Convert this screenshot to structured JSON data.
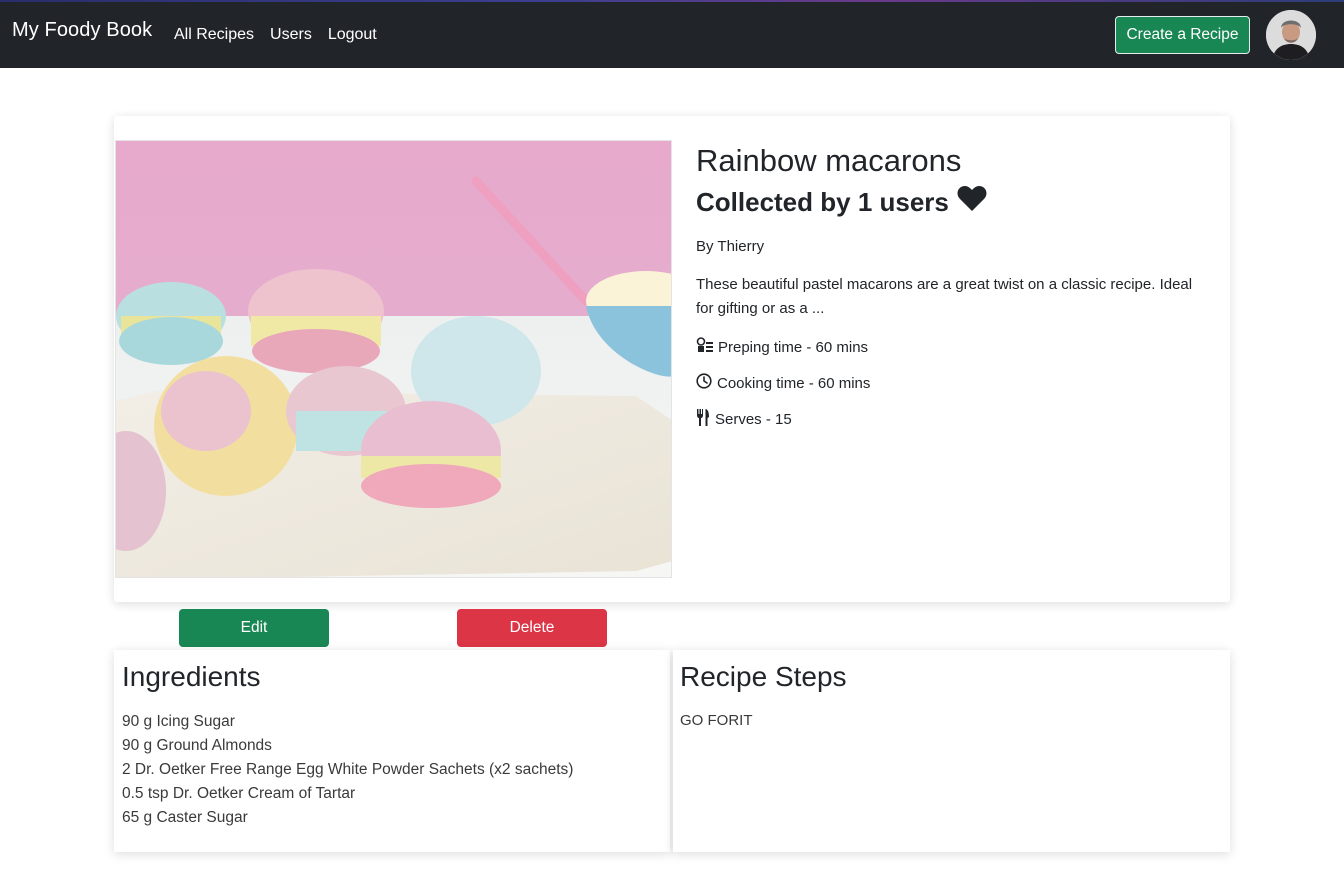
{
  "navbar": {
    "brand": "My Foody Book",
    "links": [
      "All Recipes",
      "Users",
      "Logout"
    ],
    "create_label": "Create a Recipe"
  },
  "recipe": {
    "title": "Rainbow macarons",
    "collected": "Collected by 1 users",
    "author": "By Thierry",
    "description": "These beautiful pastel macarons are a great twist on a classic recipe. Ideal for gifting or as a ...",
    "prep": "Preping time - 60 mins",
    "cook": "Cooking time - 60 mins",
    "serves": "Serves - 15"
  },
  "actions": {
    "edit_label": "Edit",
    "delete_label": "Delete"
  },
  "ingredients": {
    "heading": "Ingredients",
    "items": [
      "90 g Icing Sugar",
      "90 g Ground Almonds",
      "2 Dr. Oetker Free Range Egg White Powder Sachets (x2 sachets)",
      "0.5 tsp Dr. Oetker Cream of Tartar",
      "65 g Caster Sugar"
    ]
  },
  "steps": {
    "heading": "Recipe Steps",
    "text": "GO FORIT"
  },
  "icons": {
    "heart": "heart-icon",
    "prep": "chef-prep-icon",
    "cook": "clock-icon",
    "serves": "utensils-icon"
  },
  "colors": {
    "navbar": "#212529",
    "success": "#198754",
    "danger": "#dc3545",
    "text": "#212529"
  }
}
